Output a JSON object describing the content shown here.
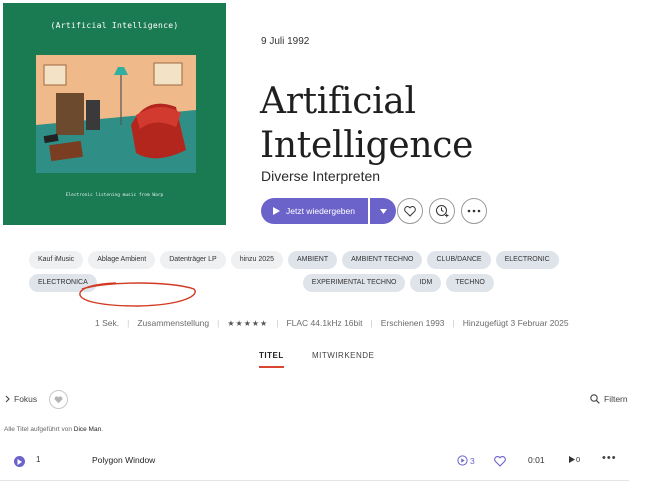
{
  "album": {
    "cover_title": "(Artificial Intelligence)",
    "cover_subtitle": "Electronic listening music from Warp",
    "release_date": "9 Juli 1992",
    "title_line1": "Artificial",
    "title_line2": "Intelligence",
    "artist": "Diverse Interpreten"
  },
  "actions": {
    "play_label": "Jetzt wiedergeben",
    "accent_color": "#6b63c9"
  },
  "tags": [
    {
      "label": "Kauf iMusic",
      "kind": "light"
    },
    {
      "label": "Ablage Ambient",
      "kind": "light"
    },
    {
      "label": "Datenträger LP",
      "kind": "light"
    },
    {
      "label": "hinzu 2025",
      "kind": "light"
    },
    {
      "label": "AMBIENT",
      "kind": "genre"
    },
    {
      "label": "AMBIENT TECHNO",
      "kind": "genre"
    },
    {
      "label": "CLUB/DANCE",
      "kind": "genre"
    },
    {
      "label": "ELECTRONIC",
      "kind": "genre"
    },
    {
      "label": "ELECTRONICA",
      "kind": "genre"
    },
    {
      "label": "EXPERIMENTAL TECHNO",
      "kind": "genre"
    },
    {
      "label": "IDM",
      "kind": "genre"
    },
    {
      "label": "TECHNO",
      "kind": "genre"
    }
  ],
  "meta": {
    "duration": "1 Sek.",
    "type": "Zusammenstellung",
    "rating": 5,
    "rating_stars": "★★★★★",
    "format": "FLAC 44.1kHz 16bit",
    "released": "Erschienen 1993",
    "added": "Hinzugefügt 3 Februar 2025"
  },
  "tabs": [
    {
      "label": "TITEL",
      "active": true
    },
    {
      "label": "MITWIRKENDE",
      "active": false
    }
  ],
  "toolbar": {
    "focus_label": "Fokus",
    "filter_label": "Filtern"
  },
  "performer_note": {
    "prefix": "Alle Titel aufgeführt von ",
    "name": "Dice Man",
    "suffix": "."
  },
  "tracks": [
    {
      "number": "1",
      "title": "Polygon Window",
      "play_count": "3",
      "duration": "0:01",
      "local_plays": "0"
    }
  ],
  "annotation_color": "#d23a22"
}
